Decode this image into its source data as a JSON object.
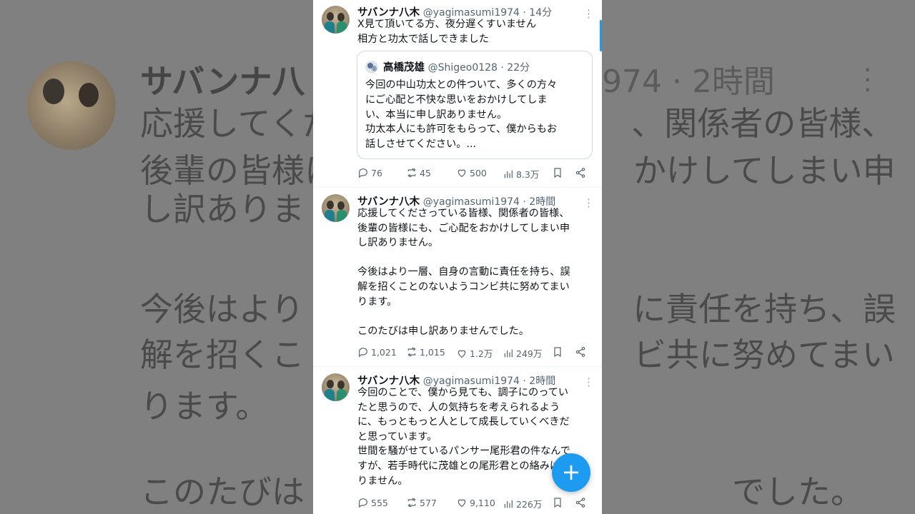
{
  "background": {
    "name": "サバンナ八",
    "handle_fragment": "974 · 2時間",
    "text_lines": [
      "応援してくだ　　　　　　　　　、関係者の皆様、",
      "後輩の皆様に　　　　　　　　　かけしてしまい申",
      "し訳ありま",
      "今後はより　　　　　　　　　　に責任を持ち、誤",
      "解を招くこ　　　　　　　　　　ビ共に努めてまい",
      "ります。",
      "このたびは　　　　　　　　　　　　　でした。"
    ]
  },
  "tweets": [
    {
      "name": "サバンナ八木",
      "handle": "@yagimasumi1974 · 14分",
      "text": "X見て頂いてる方、夜分遅くすいません\n相方と功太で話しできました",
      "quote": {
        "name": "高橋茂雄",
        "handle": "@Shigeo0128 · 22分",
        "text": "今回の中山功太との件ついて、多くの方々\nにご心配と不快な思いをおかけしてしま\nい、本当に申し訳ありません。\n功太本人にも許可をもらって、僕からもお\n話しさせてください。..."
      },
      "replies": "76",
      "retweets": "45",
      "likes": "500",
      "views": "8.3万"
    },
    {
      "name": "サバンナ八木",
      "handle": "@yagimasumi1974 · 2時間",
      "text": "応援してくださっている皆様、関係者の皆様、\n後輩の皆様にも、ご心配をおかけしてしまい申\nし訳ありません。\n\n今後はより一層、自身の言動に責任を持ち、誤\n解を招くことのないようコンビ共に努めてまい\nります。\n\nこのたびは申し訳ありませんでした。",
      "replies": "1,021",
      "retweets": "1,015",
      "likes": "1.2万",
      "views": "249万"
    },
    {
      "name": "サバンナ八木",
      "handle": "@yagimasumi1974 · 2時間",
      "text": "今回のことで、僕から見ても、調子にのってい\nたと思うので、人の気持ちを考えられるよう\nに、もっともっと人として成長していくべきだ\nと思っています。\n世間を騒がせているパンサー尾形君の件なんで\nすが、若手時代に茂雄との尾形君との絡みはあ\nりません。",
      "replies": "555",
      "retweets": "577",
      "likes": "9,110",
      "views": "226万"
    }
  ],
  "fab": {
    "label": "+"
  },
  "colors": {
    "accent": "#1d9bf0",
    "text": "#0f1419",
    "muted": "#536471"
  }
}
